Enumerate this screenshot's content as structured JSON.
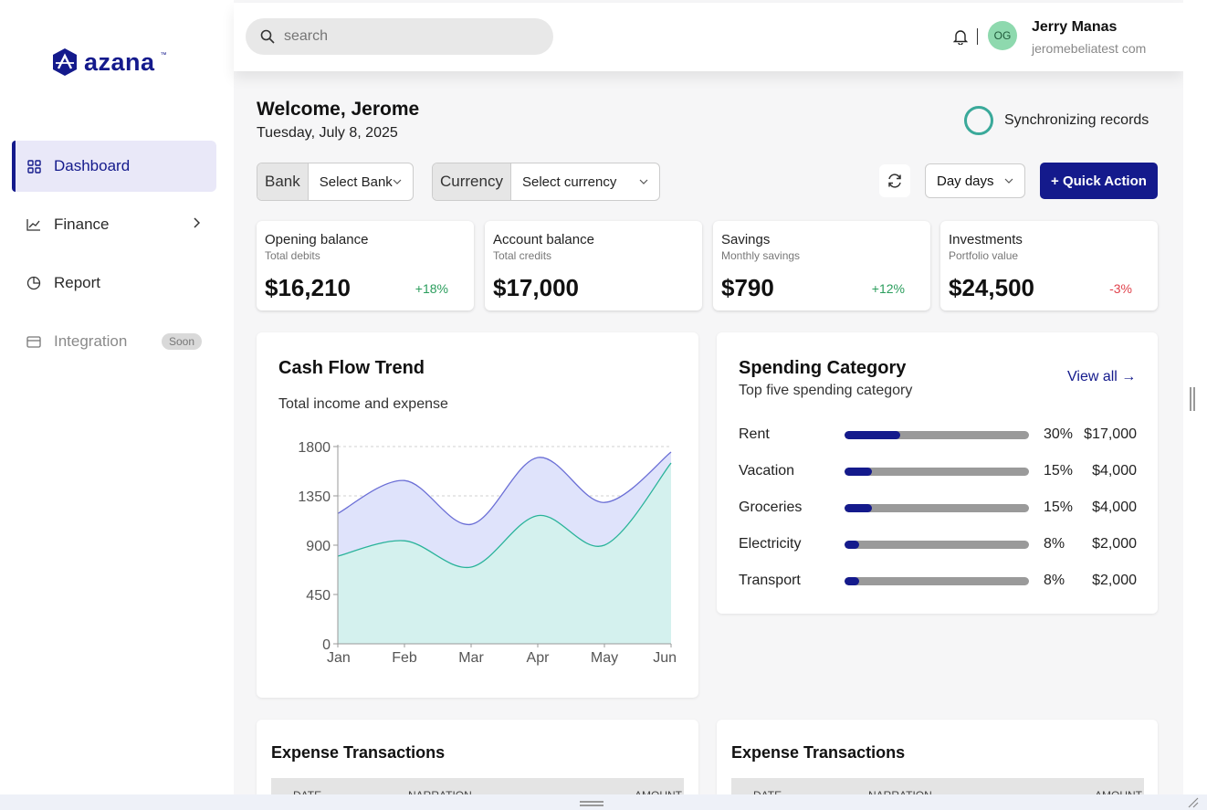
{
  "brand": {
    "name": "azana",
    "tm": "™",
    "color": "#141a8c"
  },
  "sidebar": {
    "items": [
      {
        "label": "Dashboard",
        "icon": "grid-icon"
      },
      {
        "label": "Finance",
        "icon": "line-chart-icon"
      },
      {
        "label": "Report",
        "icon": "pie-chart-icon"
      },
      {
        "label": "Integration",
        "icon": "card-icon",
        "badge": "Soon"
      }
    ]
  },
  "header": {
    "search_placeholder": "search",
    "avatar_initials": "OG",
    "user_name": "Jerry Manas",
    "user_email": "jeromebeliatest com"
  },
  "welcome": {
    "title": "Welcome, Jerome",
    "date": "Tuesday, July 8, 2025",
    "sync_status": "Synchronizing records"
  },
  "filters": {
    "bank_label": "Bank",
    "bank_value": "Select Bank",
    "currency_label": "Currency",
    "currency_value": "Select currency",
    "days_value": "Day days",
    "quick_action": "+ Quick Action"
  },
  "stats": [
    {
      "title": "Opening balance",
      "sub": "Total debits",
      "value": "$16,210",
      "change": "+18%",
      "trend": "pos"
    },
    {
      "title": "Account balance",
      "sub": "Total credits",
      "value": "$17,000",
      "change": "",
      "trend": "pos"
    },
    {
      "title": "Savings",
      "sub": "Monthly savings",
      "value": "$790",
      "change": "+12%",
      "trend": "pos"
    },
    {
      "title": "Investments",
      "sub": "Portfolio value",
      "value": "$24,500",
      "change": "-3%",
      "trend": "neg"
    }
  ],
  "cashflow": {
    "title": "Cash Flow Trend",
    "subtitle": "Total income and expense"
  },
  "chart_data": {
    "type": "area",
    "x": [
      "Jan",
      "Feb",
      "Mar",
      "Apr",
      "May",
      "Jun"
    ],
    "series": [
      {
        "values": [
          1190,
          1490,
          1090,
          1700,
          1290,
          1750
        ],
        "color": "#6b6fd6",
        "fill": "#dfe3fb"
      },
      {
        "values": [
          800,
          940,
          700,
          1170,
          900,
          1650
        ],
        "color": "#2ab39a",
        "fill": "#d4f1ee"
      }
    ],
    "ylim": [
      0,
      1800
    ],
    "yticks": [
      0,
      450,
      900,
      1350,
      1800
    ],
    "grid": "horizontal-dashed"
  },
  "spending": {
    "title": "Spending Category",
    "subtitle": "Top five spending category",
    "view_all": "View all →",
    "items": [
      {
        "name": "Rent",
        "pct_label": "30%",
        "pct": 30,
        "amount": "$17,000"
      },
      {
        "name": "Vacation",
        "pct_label": "15%",
        "pct": 15,
        "amount": "$4,000"
      },
      {
        "name": "Groceries",
        "pct_label": "15%",
        "pct": 15,
        "amount": "$4,000"
      },
      {
        "name": "Electricity",
        "pct_label": "8%",
        "pct": 8,
        "amount": "$2,000"
      },
      {
        "name": "Transport",
        "pct_label": "8%",
        "pct": 8,
        "amount": "$2,000"
      }
    ]
  },
  "transactions": [
    {
      "title": "Expense Transactions",
      "columns": [
        "DATE",
        "NARRATION",
        "AMOUNT"
      ]
    },
    {
      "title": "Expense Transactions",
      "columns": [
        "DATE",
        "NARRATION",
        "AMOUNT"
      ]
    }
  ]
}
